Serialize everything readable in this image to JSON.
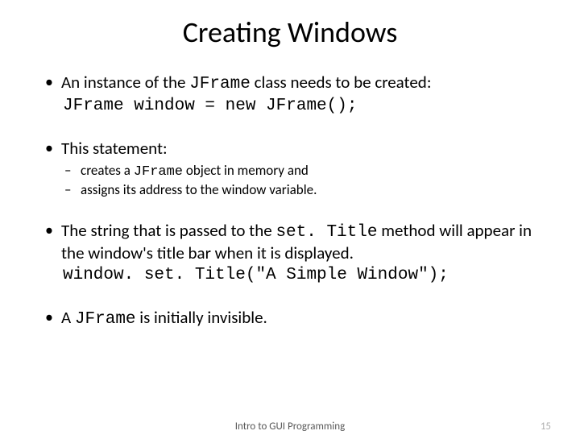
{
  "title": "Creating Windows",
  "bullets": {
    "b1": {
      "text_pre": "An instance of the ",
      "code1": "JFrame",
      "text_post": " class needs to be created:",
      "codeline": "JFrame window = new JFrame();"
    },
    "b2": {
      "text": "This statement:",
      "sub1_pre": "creates a ",
      "sub1_code": "JFrame",
      "sub1_post": " object in memory and",
      "sub2": "assigns its address to the window variable."
    },
    "b3": {
      "text_pre": "The string that is passed to the ",
      "code1": "set. Title",
      "text_post": " method will appear in the window's title bar when it is displayed.",
      "codeline": "window. set. Title(\"A Simple Window\");"
    },
    "b4": {
      "text_pre": "A ",
      "code1": "JFrame",
      "text_post": " is initially invisible."
    }
  },
  "footer": {
    "center": "Intro to GUI Programming",
    "page": "15"
  }
}
